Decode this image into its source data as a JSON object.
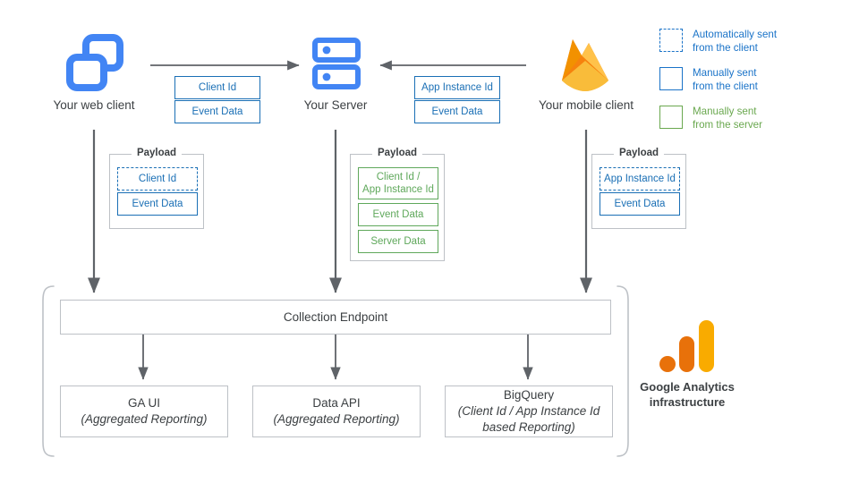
{
  "nodes": {
    "web_client": {
      "label": "Your web client",
      "icon": "browser-windows-icon"
    },
    "server": {
      "label": "Your Server",
      "icon": "server-racks-icon"
    },
    "mobile_client": {
      "label": "Your mobile client",
      "icon": "firebase-flame-icon"
    },
    "ga_infrastructure": {
      "label_line1": "Google Analytics",
      "label_line2": "infrastructure",
      "icon": "google-analytics-icon"
    }
  },
  "transit": {
    "web_to_server": {
      "chips": [
        "Client Id",
        "Event Data"
      ]
    },
    "mobile_to_server": {
      "chips": [
        "App Instance Id",
        "Event Data"
      ]
    }
  },
  "payloads": {
    "legend_title": "Payload",
    "web": {
      "title": "Payload",
      "items": [
        {
          "label": "Client Id",
          "style": "blue-dashed"
        },
        {
          "label": "Event Data",
          "style": "blue"
        }
      ]
    },
    "server": {
      "title": "Payload",
      "items": [
        {
          "label": "Client Id /\nApp Instance Id",
          "style": "green"
        },
        {
          "label": "Event Data",
          "style": "green"
        },
        {
          "label": "Server Data",
          "style": "green"
        }
      ]
    },
    "mobile": {
      "title": "Payload",
      "items": [
        {
          "label": "App Instance Id",
          "style": "blue-dashed"
        },
        {
          "label": "Event Data",
          "style": "blue"
        }
      ]
    }
  },
  "pipeline": {
    "collection_endpoint": {
      "label": "Collection Endpoint"
    },
    "outputs": [
      {
        "title": "GA UI",
        "subtitle": "(Aggregated Reporting)"
      },
      {
        "title": "Data API",
        "subtitle": "(Aggregated Reporting)"
      },
      {
        "title": "BigQuery",
        "subtitle": "(Client Id / App Instance Id\nbased Reporting)"
      }
    ]
  },
  "legend": {
    "items": [
      {
        "swatch": "dashed-blue-square",
        "text": "Automatically sent\nfrom the client",
        "color": "#1a73c8"
      },
      {
        "swatch": "solid-blue-square",
        "text": "Manually sent\nfrom the client",
        "color": "#1a73c8"
      },
      {
        "swatch": "solid-green-square",
        "text": "Manually sent\nfrom the server",
        "color": "#6aa84f"
      }
    ]
  },
  "colors": {
    "blue_accent": "#1a73c8",
    "chip_blue": "#1a6fb5",
    "green_accent": "#6aa84f",
    "chip_green": "#5fa85b",
    "icon_blue": "#4285f4",
    "grey_border": "#bdc1c6",
    "arrow_grey": "#5f6368",
    "ga_orange_dark": "#e8710a",
    "ga_orange": "#e8710a",
    "ga_yellow": "#f9ab00",
    "firebase_yellow": "#ffc24a",
    "firebase_amber": "#f4bd62",
    "firebase_orange": "#f6820d",
    "text_dark": "#3c4043"
  }
}
